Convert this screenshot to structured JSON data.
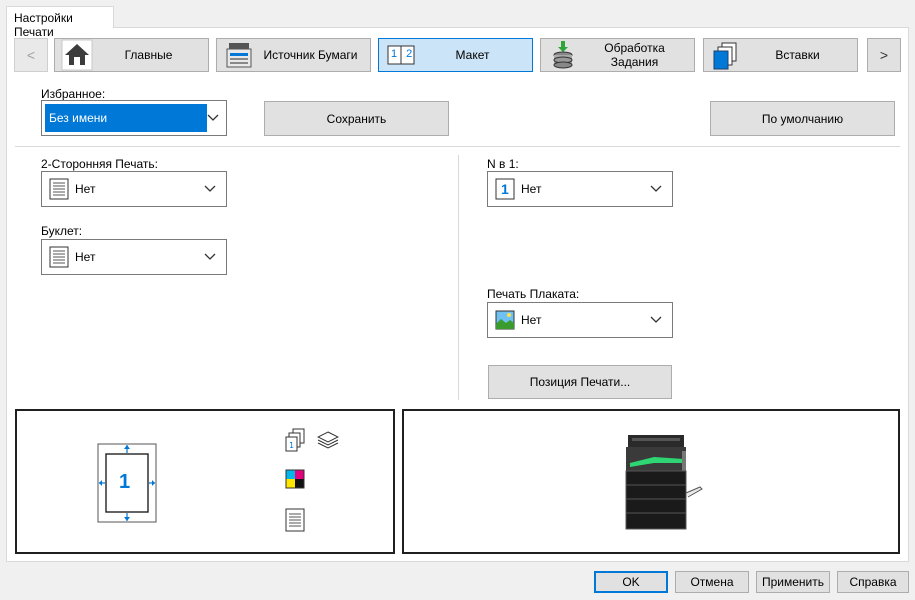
{
  "window": {
    "tab_label": "Настройки Печати"
  },
  "categories": [
    {
      "label": "Главные",
      "icon": "home-icon"
    },
    {
      "label": "Источник Бумаги",
      "icon": "paper-source-icon"
    },
    {
      "label": "Макет",
      "icon": "layout-icon",
      "active": true,
      "icon_text": "1 2"
    },
    {
      "label": "Обработка Задания",
      "icon": "job-handling-icon"
    },
    {
      "label": "Вставки",
      "icon": "inserts-icon"
    }
  ],
  "nav": {
    "prev": "<",
    "next": ">"
  },
  "favorites": {
    "label": "Избранное:",
    "value": "Без имени",
    "save_label": "Сохранить",
    "default_label": "По умолчанию"
  },
  "layout": {
    "duplex": {
      "label": "2-Сторонняя Печать:",
      "value": "Нет",
      "icon": "document-icon"
    },
    "booklet": {
      "label": "Буклет:",
      "value": "Нет",
      "icon": "document-icon"
    },
    "n_up": {
      "label": "N в 1:",
      "value": "Нет",
      "icon": "page-one-icon",
      "icon_text": "1"
    },
    "poster": {
      "label": "Печать Плаката:",
      "value": "Нет",
      "icon": "poster-icon"
    },
    "position_label": "Позиция Печати..."
  },
  "preview": {
    "page_number": "1",
    "status_icons": [
      "collate-icon",
      "stack-icon",
      "color-icon",
      "single-sided-icon"
    ]
  },
  "footer": {
    "ok": "OK",
    "cancel": "Отмена",
    "apply": "Применить",
    "help": "Справка"
  },
  "colors": {
    "accent": "#0078d7",
    "active_bg": "#cce4f7",
    "button_bg": "#e1e1e1"
  }
}
